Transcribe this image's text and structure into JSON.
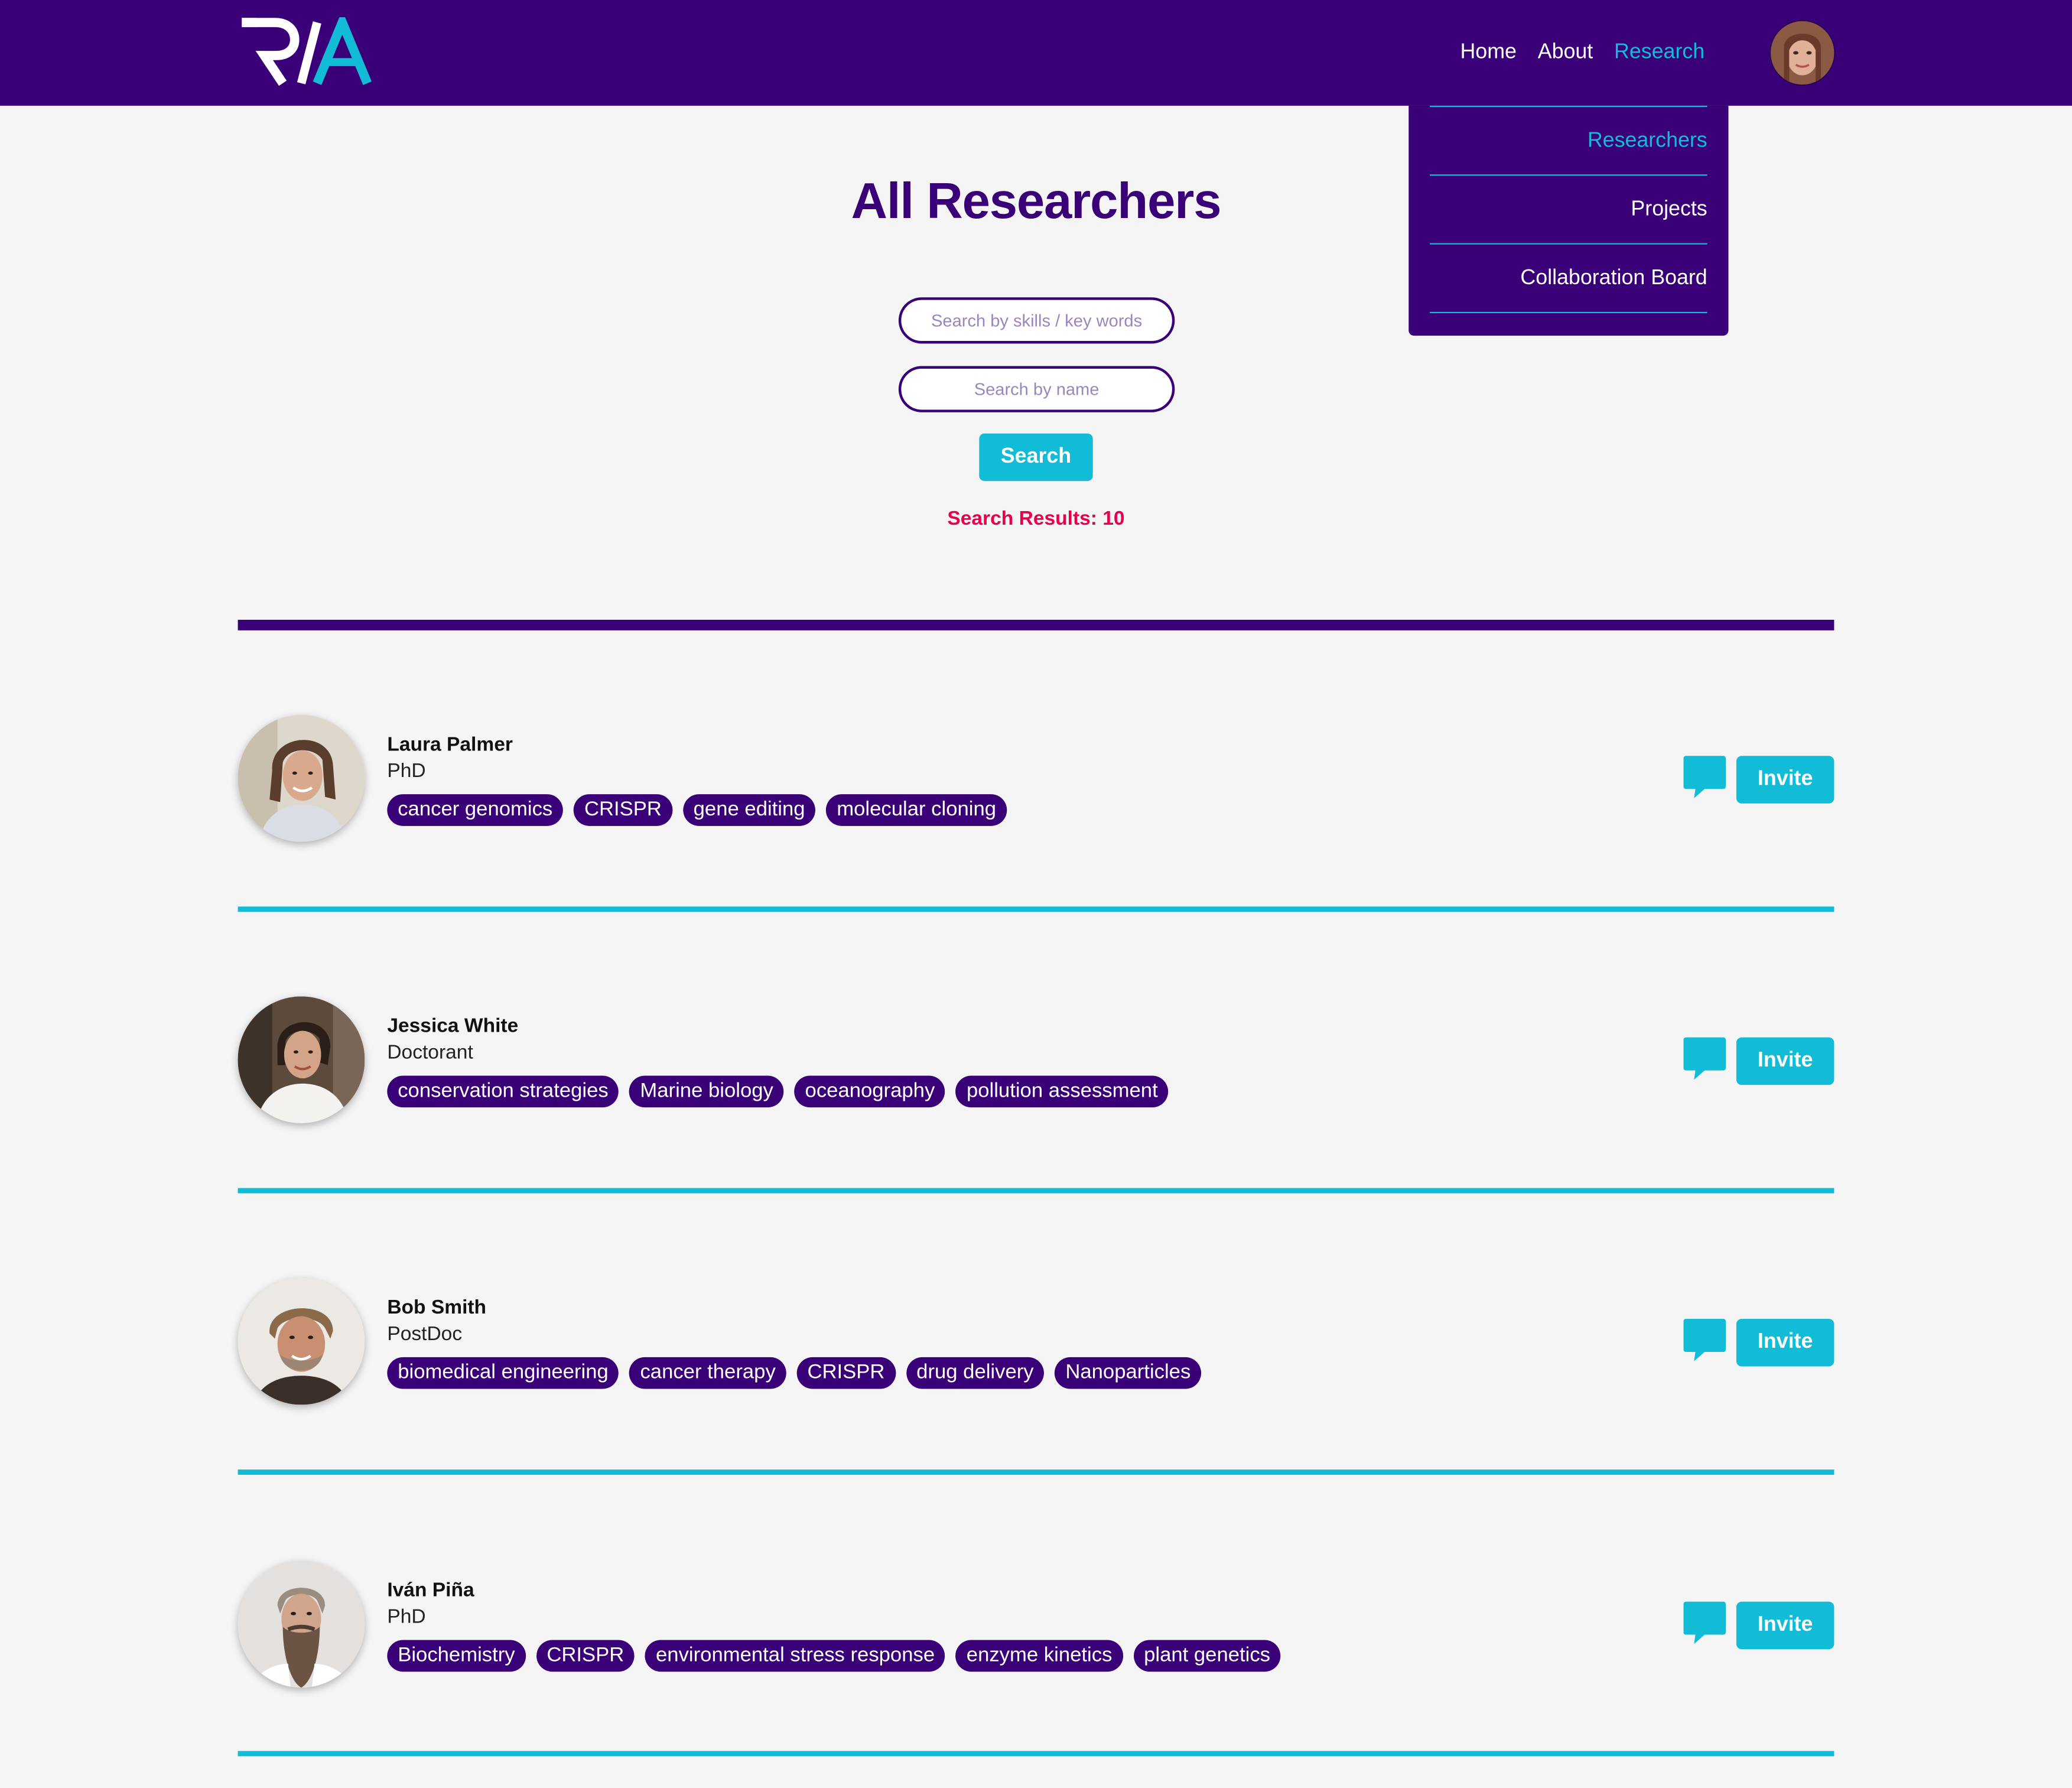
{
  "header": {
    "logo_text": "R/A",
    "nav": [
      {
        "label": "Home"
      },
      {
        "label": "About"
      },
      {
        "label": "Research"
      }
    ],
    "active_nav": "Research",
    "dropdown": [
      {
        "label": "Researchers"
      },
      {
        "label": "Projects"
      },
      {
        "label": "Collaboration Board"
      }
    ],
    "active_dropdown": "Researchers"
  },
  "page": {
    "title": "All Researchers",
    "search": {
      "skills_placeholder": "Search by skills / key words",
      "name_placeholder": "Search by name",
      "button_label": "Search"
    },
    "results_text": "Search Results: 10"
  },
  "researchers": [
    {
      "name": "Laura Palmer",
      "degree": "PhD",
      "tags": [
        "cancer genomics",
        "CRISPR",
        "gene editing",
        "molecular cloning"
      ],
      "invite_label": "Invite"
    },
    {
      "name": "Jessica White",
      "degree": "Doctorant",
      "tags": [
        "conservation strategies",
        "Marine biology",
        "oceanography",
        "pollution assessment"
      ],
      "invite_label": "Invite"
    },
    {
      "name": "Bob Smith",
      "degree": "PostDoc",
      "tags": [
        "biomedical engineering",
        "cancer therapy",
        "CRISPR",
        "drug delivery",
        "Nanoparticles"
      ],
      "invite_label": "Invite"
    },
    {
      "name": "Iván Piña",
      "degree": "PhD",
      "tags": [
        "Biochemistry",
        "CRISPR",
        "environmental stress response",
        "enzyme kinetics",
        "plant genetics"
      ],
      "invite_label": "Invite"
    }
  ],
  "colors": {
    "brand_purple": "#3a0077",
    "accent_cyan": "#12bcd6",
    "results_pink": "#e8004c",
    "background": "#f5f5f6"
  },
  "icons": {
    "chat": "chat-bubble-icon",
    "avatar": "user-avatar"
  }
}
